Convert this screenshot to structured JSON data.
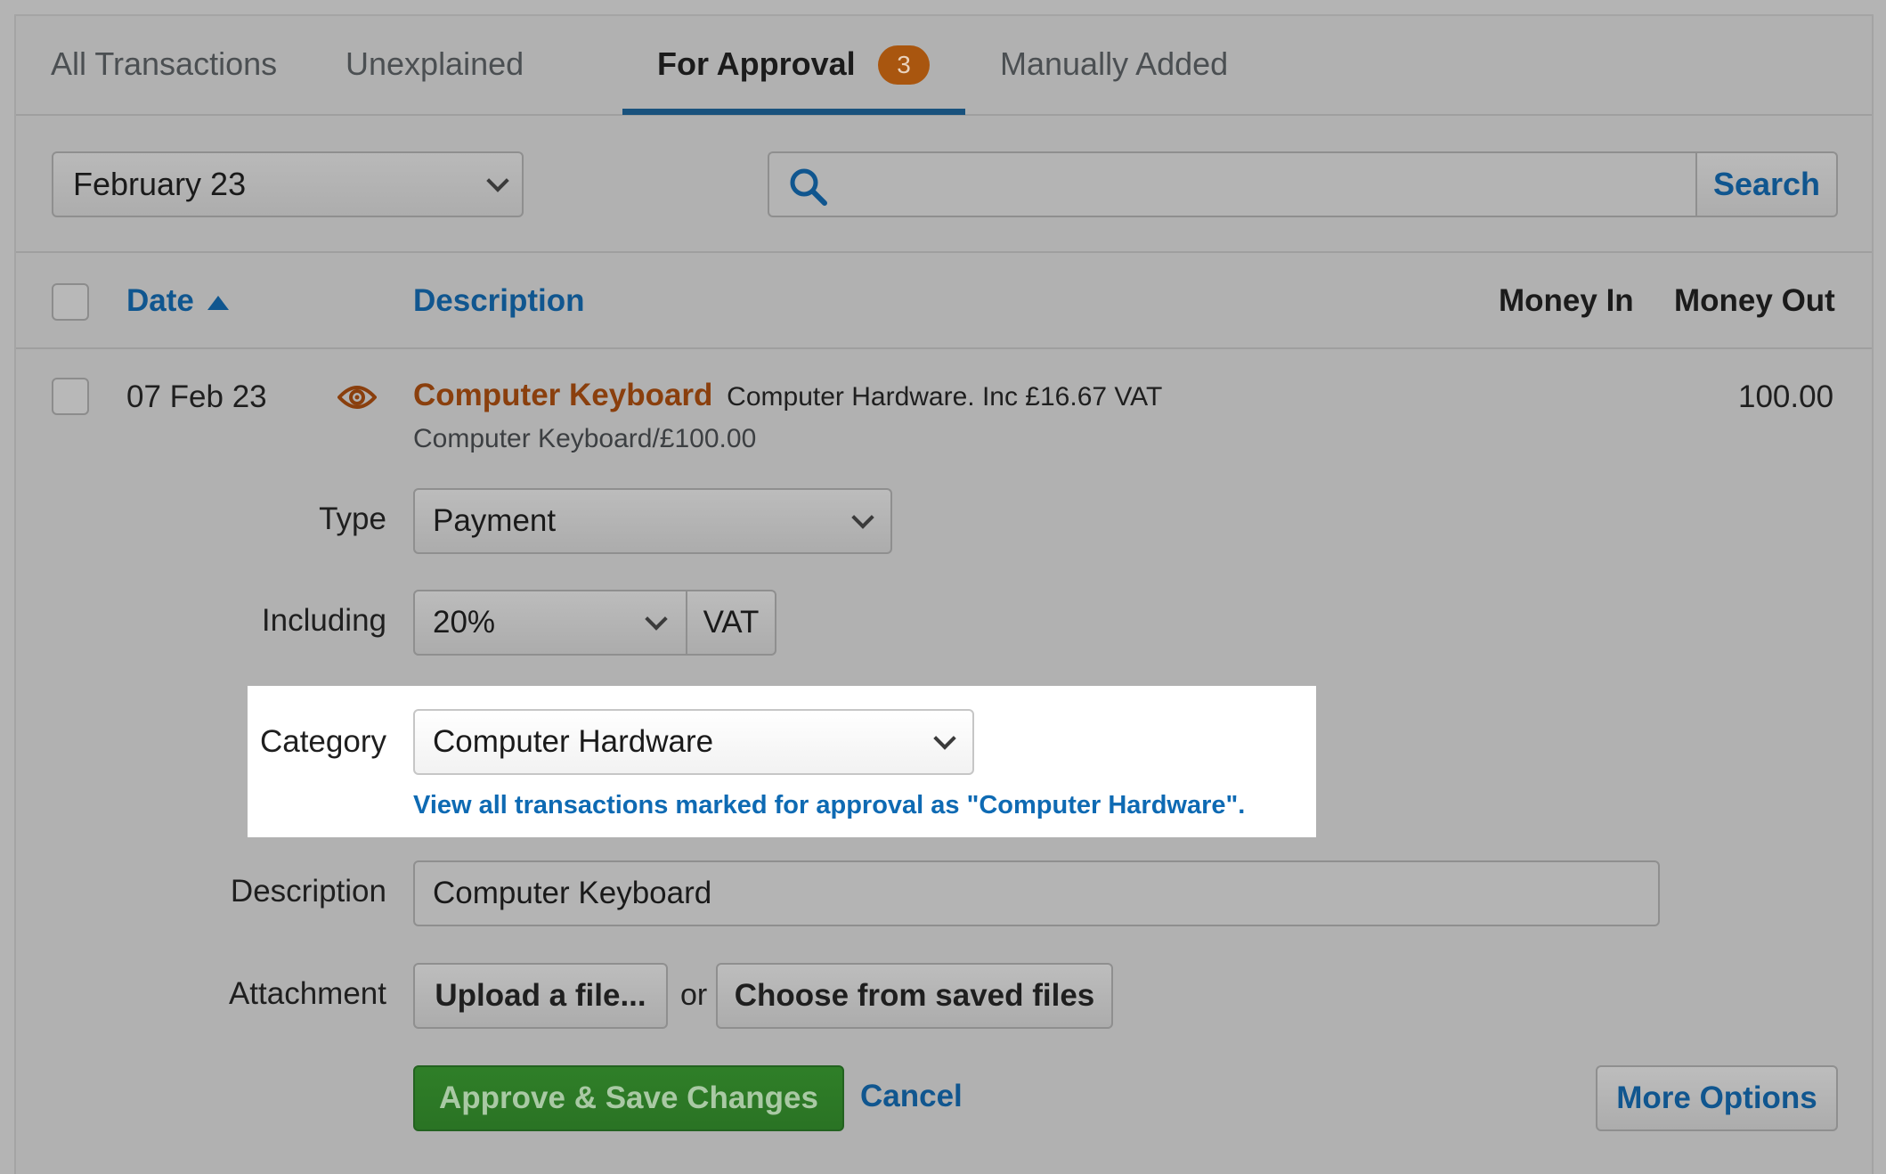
{
  "tabs": [
    {
      "label": "All Transactions"
    },
    {
      "label": "Unexplained"
    },
    {
      "label": "For Approval",
      "badge": "3",
      "active": true
    },
    {
      "label": "Manually Added"
    }
  ],
  "filter": {
    "month": "February 23"
  },
  "search": {
    "placeholder": "",
    "button_label": "Search"
  },
  "table": {
    "headers": {
      "date": "Date",
      "description": "Description",
      "money_in": "Money In",
      "money_out": "Money Out"
    },
    "row": {
      "date": "07 Feb 23",
      "title": "Computer Keyboard",
      "detail": "Computer Hardware. Inc £16.67 VAT",
      "subtitle": "Computer Keyboard/£100.00",
      "money_out": "100.00"
    }
  },
  "form": {
    "type_label": "Type",
    "type_value": "Payment",
    "including_label": "Including",
    "vat_rate": "20%",
    "vat_addon": "VAT",
    "category_label": "Category",
    "category_value": "Computer Hardware",
    "category_link": "View all transactions marked for approval as \"Computer Hardware\".",
    "description_label": "Description",
    "description_value": "Computer Keyboard",
    "attachment_label": "Attachment",
    "upload_button": "Upload a file...",
    "or_text": "or",
    "saved_files_button": "Choose from saved files",
    "approve_button": "Approve & Save Changes",
    "cancel_link": "Cancel",
    "more_options_button": "More Options"
  },
  "colors": {
    "accent_blue": "#10568f",
    "badge_orange": "#a9560f",
    "approve_green": "#2d7a27",
    "title_orange": "#8a3f0d"
  }
}
